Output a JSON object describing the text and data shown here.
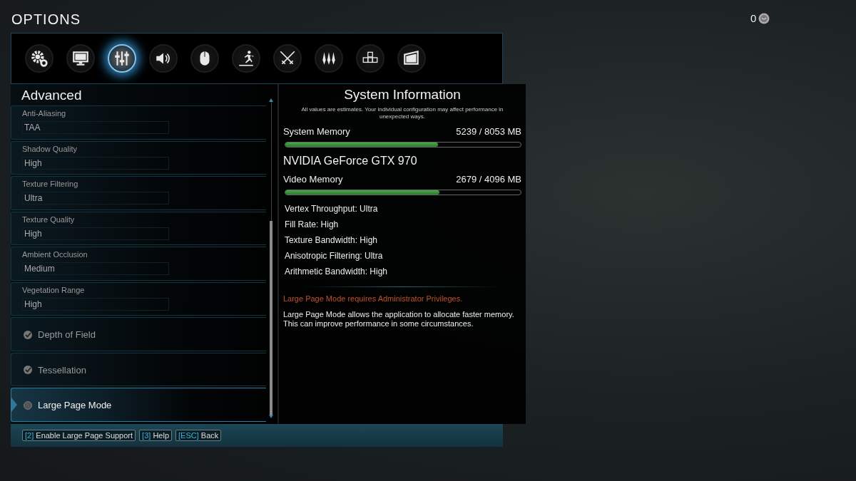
{
  "title": "OPTIONS",
  "currency": {
    "amount": "0"
  },
  "tabs": [
    {
      "kind": "gears",
      "selected": false
    },
    {
      "kind": "monitor",
      "selected": false
    },
    {
      "kind": "sliders",
      "selected": true
    },
    {
      "kind": "speaker",
      "selected": false
    },
    {
      "kind": "mouse",
      "selected": false
    },
    {
      "kind": "runner",
      "selected": false
    },
    {
      "kind": "swords",
      "selected": false
    },
    {
      "kind": "blades",
      "selected": false
    },
    {
      "kind": "keys",
      "selected": false
    },
    {
      "kind": "screen",
      "selected": false
    }
  ],
  "section_title": "Advanced",
  "settings": [
    {
      "kind": "dropdown",
      "label": "Anti-Aliasing",
      "value": "TAA",
      "selected": false
    },
    {
      "kind": "dropdown",
      "label": "Shadow Quality",
      "value": "High",
      "selected": false
    },
    {
      "kind": "dropdown",
      "label": "Texture Filtering",
      "value": "Ultra",
      "selected": false
    },
    {
      "kind": "dropdown",
      "label": "Texture Quality",
      "value": "High",
      "selected": false
    },
    {
      "kind": "dropdown",
      "label": "Ambient Occlusion",
      "value": "Medium",
      "selected": false
    },
    {
      "kind": "dropdown",
      "label": "Vegetation Range",
      "value": "High",
      "selected": false
    },
    {
      "kind": "checkbox",
      "label": "Depth of Field",
      "checked": true,
      "selected": false
    },
    {
      "kind": "checkbox",
      "label": "Tessellation",
      "checked": true,
      "selected": false
    },
    {
      "kind": "checkbox",
      "label": "Large Page Mode",
      "checked": false,
      "selected": true
    }
  ],
  "info": {
    "title": "System Information",
    "note": "All values are estimates. Your individual configuration may affect performance in unexpected ways.",
    "system_memory": {
      "label": "System Memory",
      "reading": "5239 / 8053 MB",
      "level": 0.65
    },
    "gpu": "NVIDIA GeForce GTX 970",
    "video_memory": {
      "label": "Video Memory",
      "reading": "2679 / 4096 MB",
      "level": 0.654
    },
    "ratings": [
      "Vertex Throughput: Ultra",
      "Fill Rate: High",
      "Texture Bandwidth: High",
      "Anisotropic Filtering: Ultra",
      "Arithmetic Bandwidth: High"
    ],
    "warning": "Large Page Mode requires Administrator Privileges.",
    "description": "Large Page Mode allows the application to allocate faster memory. This can improve performance in some circumstances."
  },
  "footer": [
    {
      "key": "[2]",
      "label": "Enable Large Page Support"
    },
    {
      "key": "[3]",
      "label": "Help"
    },
    {
      "key": "[ESC]",
      "label": "Back"
    }
  ]
}
